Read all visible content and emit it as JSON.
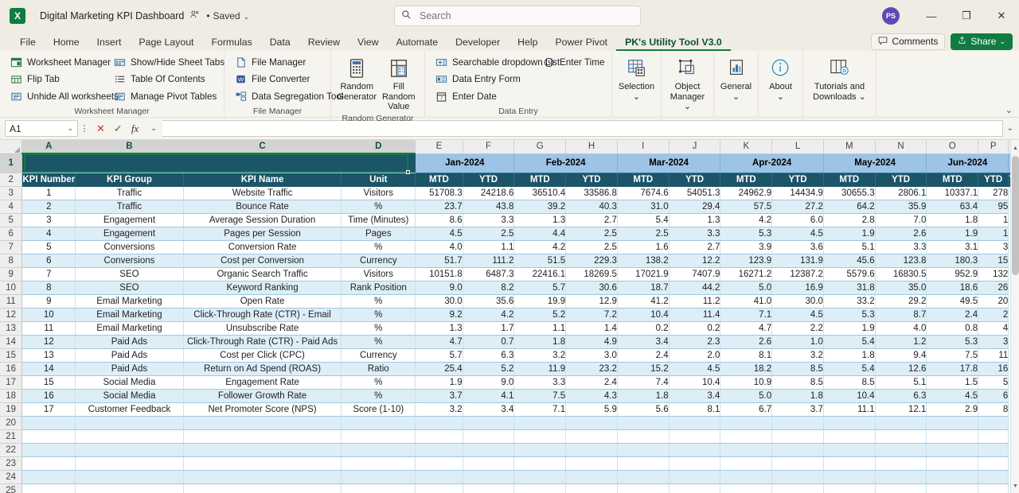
{
  "titlebar": {
    "logo_text": "X",
    "document_title": "Digital Marketing KPI Dashboard",
    "person_icon": "person-shared-icon",
    "saved_dot": "•",
    "saved_label": "Saved",
    "saved_chevron": "⌄",
    "search_placeholder": "Search",
    "search_value": "",
    "search_icon": "search-icon",
    "avatar_initials": "PS",
    "minimize": "—",
    "restore": "❐",
    "close": "✕"
  },
  "ribbon_tabs": {
    "items": [
      {
        "label": "File",
        "active": false
      },
      {
        "label": "Home",
        "active": false
      },
      {
        "label": "Insert",
        "active": false
      },
      {
        "label": "Page Layout",
        "active": false
      },
      {
        "label": "Formulas",
        "active": false
      },
      {
        "label": "Data",
        "active": false
      },
      {
        "label": "Review",
        "active": false
      },
      {
        "label": "View",
        "active": false
      },
      {
        "label": "Automate",
        "active": false
      },
      {
        "label": "Developer",
        "active": false
      },
      {
        "label": "Help",
        "active": false
      },
      {
        "label": "Power Pivot",
        "active": false
      },
      {
        "label": "PK's Utility Tool V3.0",
        "active": true
      }
    ],
    "comments_label": "Comments",
    "comments_icon": "comment-bubble-icon",
    "share_label": "Share",
    "share_icon": "share-icon",
    "share_chevron": "⌄",
    "accent_green": "#107c41",
    "share_bg": "#107c41"
  },
  "ribbon": {
    "collapse_chevron": "⌄",
    "groups": [
      {
        "name": "Worksheet Manager",
        "columns": [
          [
            "Worksheet Manager",
            "Flip Tab",
            "Unhide All worksheets"
          ],
          [
            "Show/Hide Sheet Tabs",
            "Table Of Contents",
            "Manage Pivot Tables"
          ]
        ]
      },
      {
        "name": "File Manager",
        "columns": [
          [
            "File Manager",
            "File Converter",
            "Data Segregation Tool"
          ]
        ]
      }
    ],
    "random_generator": {
      "name": "Random Generator",
      "buttons": [
        {
          "label_line1": "Random",
          "label_line2": "Generator",
          "icon": "calculator-icon"
        },
        {
          "label_line1": "Fill Random",
          "label_line2": "Value",
          "icon": "table-fill-icon"
        }
      ]
    },
    "data_entry": {
      "name": "Data Entry",
      "col1": [
        "Searchable dropdown List",
        "Data Entry Form",
        "Enter Date"
      ],
      "col2": [
        "Enter Time"
      ]
    },
    "right_buttons": [
      {
        "label_line1": "Selection",
        "label_line2": "⌄",
        "icon": "grid-selection-icon"
      },
      {
        "label_line1": "Object",
        "label_line2": "Manager ⌄",
        "icon": "object-manager-icon"
      },
      {
        "label_line1": "General",
        "label_line2": "⌄",
        "icon": "chart-icon"
      },
      {
        "label_line1": "About",
        "label_line2": "⌄",
        "icon": "info-icon"
      },
      {
        "label_line1": "Tutorials and",
        "label_line2": "Downloads ⌄",
        "icon": "tutorials-icon"
      }
    ]
  },
  "formula_bar": {
    "name_box_value": "A1",
    "name_box_chevron": "⌄",
    "more_dots": "⋮",
    "cancel_icon": "✕",
    "enter_icon": "✓",
    "function_icon": "fx",
    "function_chevron": "⌄",
    "formula_value": "",
    "expand_chevron": "⌄"
  },
  "grid": {
    "column_letters": [
      "A",
      "B",
      "C",
      "D",
      "E",
      "F",
      "G",
      "H",
      "I",
      "J",
      "K",
      "L",
      "M",
      "N",
      "O",
      "P"
    ],
    "selected_columns": [
      "A",
      "B",
      "C",
      "D"
    ],
    "row_numbers": [
      1,
      2,
      3,
      4,
      5,
      6,
      7,
      8,
      9,
      10,
      11,
      12,
      13,
      14,
      15,
      16,
      17,
      18,
      19,
      20,
      21,
      22,
      23,
      24,
      25
    ],
    "selected_rows": [
      1
    ],
    "active_cell": "A1",
    "row1_months": [
      "Jan-2024",
      "Feb-2024",
      "Mar-2024",
      "Apr-2024",
      "May-2024",
      "Jun-2024"
    ],
    "headers": [
      "KPI Number",
      "KPI Group",
      "KPI Name",
      "Unit"
    ],
    "sub_headers": [
      "MTD",
      "YTD"
    ],
    "header_fill": "#1c5468",
    "month_fill": "#9dc3e6",
    "band_fill": "#ddeef7",
    "rows": [
      {
        "n": "1",
        "group": "Traffic",
        "name": "Website Traffic",
        "unit": "Visitors",
        "vals": [
          "51708.3",
          "24218.6",
          "36510.4",
          "33586.8",
          "7674.6",
          "54051.3",
          "24962.9",
          "14434.9",
          "30655.3",
          "2806.1",
          "10337.1",
          "278"
        ]
      },
      {
        "n": "2",
        "group": "Traffic",
        "name": "Bounce Rate",
        "unit": "%",
        "vals": [
          "23.7",
          "43.8",
          "39.2",
          "40.3",
          "31.0",
          "29.4",
          "57.5",
          "27.2",
          "64.2",
          "35.9",
          "63.4",
          "95"
        ]
      },
      {
        "n": "3",
        "group": "Engagement",
        "name": "Average Session Duration",
        "unit": "Time (Minutes)",
        "vals": [
          "8.6",
          "3.3",
          "1.3",
          "2.7",
          "5.4",
          "1.3",
          "4.2",
          "6.0",
          "2.8",
          "7.0",
          "1.8",
          "1"
        ]
      },
      {
        "n": "4",
        "group": "Engagement",
        "name": "Pages per Session",
        "unit": "Pages",
        "vals": [
          "4.5",
          "2.5",
          "4.4",
          "2.5",
          "2.5",
          "3.3",
          "5.3",
          "4.5",
          "1.9",
          "2.6",
          "1.9",
          "1"
        ]
      },
      {
        "n": "5",
        "group": "Conversions",
        "name": "Conversion Rate",
        "unit": "%",
        "vals": [
          "4.0",
          "1.1",
          "4.2",
          "2.5",
          "1.6",
          "2.7",
          "3.9",
          "3.6",
          "5.1",
          "3.3",
          "3.1",
          "3"
        ]
      },
      {
        "n": "6",
        "group": "Conversions",
        "name": "Cost per Conversion",
        "unit": "Currency",
        "vals": [
          "51.7",
          "111.2",
          "51.5",
          "229.3",
          "138.2",
          "12.2",
          "123.9",
          "131.9",
          "45.6",
          "123.8",
          "180.3",
          "15"
        ]
      },
      {
        "n": "7",
        "group": "SEO",
        "name": "Organic Search Traffic",
        "unit": "Visitors",
        "vals": [
          "10151.8",
          "6487.3",
          "22416.1",
          "18269.5",
          "17021.9",
          "7407.9",
          "16271.2",
          "12387.2",
          "5579.6",
          "16830.5",
          "952.9",
          "132"
        ]
      },
      {
        "n": "8",
        "group": "SEO",
        "name": "Keyword Ranking",
        "unit": "Rank Position",
        "vals": [
          "9.0",
          "8.2",
          "5.7",
          "30.6",
          "18.7",
          "44.2",
          "5.0",
          "16.9",
          "31.8",
          "35.0",
          "18.6",
          "26"
        ]
      },
      {
        "n": "9",
        "group": "Email Marketing",
        "name": "Open Rate",
        "unit": "%",
        "vals": [
          "30.0",
          "35.6",
          "19.9",
          "12.9",
          "41.2",
          "11.2",
          "41.0",
          "30.0",
          "33.2",
          "29.2",
          "49.5",
          "20"
        ]
      },
      {
        "n": "10",
        "group": "Email Marketing",
        "name": "Click-Through Rate (CTR) - Email",
        "unit": "%",
        "vals": [
          "9.2",
          "4.2",
          "5.2",
          "7.2",
          "10.4",
          "11.4",
          "7.1",
          "4.5",
          "5.3",
          "8.7",
          "2.4",
          "2"
        ]
      },
      {
        "n": "11",
        "group": "Email Marketing",
        "name": "Unsubscribe Rate",
        "unit": "%",
        "vals": [
          "1.3",
          "1.7",
          "1.1",
          "1.4",
          "0.2",
          "0.2",
          "4.7",
          "2.2",
          "1.9",
          "4.0",
          "0.8",
          "4"
        ]
      },
      {
        "n": "12",
        "group": "Paid Ads",
        "name": "Click-Through Rate (CTR) - Paid Ads",
        "unit": "%",
        "vals": [
          "4.7",
          "0.7",
          "1.8",
          "4.9",
          "3.4",
          "2.3",
          "2.6",
          "1.0",
          "5.4",
          "1.2",
          "5.3",
          "3"
        ]
      },
      {
        "n": "13",
        "group": "Paid Ads",
        "name": "Cost per Click (CPC)",
        "unit": "Currency",
        "vals": [
          "5.7",
          "6.3",
          "3.2",
          "3.0",
          "2.4",
          "2.0",
          "8.1",
          "3.2",
          "1.8",
          "9.4",
          "7.5",
          "11"
        ]
      },
      {
        "n": "14",
        "group": "Paid Ads",
        "name": "Return on Ad Spend (ROAS)",
        "unit": "Ratio",
        "vals": [
          "25.4",
          "5.2",
          "11.9",
          "23.2",
          "15.2",
          "4.5",
          "18.2",
          "8.5",
          "5.4",
          "12.6",
          "17.8",
          "16"
        ]
      },
      {
        "n": "15",
        "group": "Social Media",
        "name": "Engagement Rate",
        "unit": "%",
        "vals": [
          "1.9",
          "9.0",
          "3.3",
          "2.4",
          "7.4",
          "10.4",
          "10.9",
          "8.5",
          "8.5",
          "5.1",
          "1.5",
          "5"
        ]
      },
      {
        "n": "16",
        "group": "Social Media",
        "name": "Follower Growth Rate",
        "unit": "%",
        "vals": [
          "3.7",
          "4.1",
          "7.5",
          "4.3",
          "1.8",
          "3.4",
          "5.0",
          "1.8",
          "10.4",
          "6.3",
          "4.5",
          "6"
        ]
      },
      {
        "n": "17",
        "group": "Customer Feedback",
        "name": "Net Promoter Score (NPS)",
        "unit": "Score (1-10)",
        "vals": [
          "3.2",
          "3.4",
          "7.1",
          "5.9",
          "5.6",
          "8.1",
          "6.7",
          "3.7",
          "11.1",
          "12.1",
          "2.9",
          "8"
        ]
      }
    ]
  }
}
